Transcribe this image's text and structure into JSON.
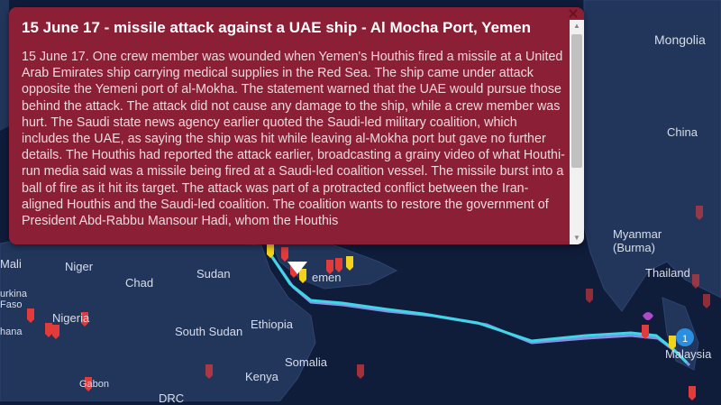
{
  "popup": {
    "title": "15 June 17 - missile attack against a UAE ship - Al Mocha Port, Yemen",
    "body": "15 June 17. One crew member was wounded when Yemen's Houthis fired a missile at a United Arab Emirates ship carrying medical supplies in the Red Sea. The ship came under attack opposite the Yemeni port of al-Mokha. The statement warned that the UAE would pursue those behind the attack. The attack did not cause any damage to the ship, while a crew member was hurt. The Saudi state news agency earlier quoted the Saudi-led military coalition, which includes the UAE, as saying the ship was hit while leaving al-Mokha port but gave no further details. The Houthis had reported the attack earlier, broadcasting a grainy video of what Houthi-run media said was a missile being fired at a Saudi-led coalition vessel. The missile burst into a ball of fire as it hit its target. The attack was part of a protracted conflict between the Iran-aligned Houthis and the Saudi-led coalition. The coalition wants to restore the government of President Abd-Rabbu Mansour Hadi, whom the Houthis",
    "close_glyph": "×"
  },
  "map_labels": {
    "mongolia": "Mongolia",
    "china": "China",
    "myanmar": "Myanmar\n(Burma)",
    "thailand": "Thailand",
    "mali": "Mali",
    "niger": "Niger",
    "chad": "Chad",
    "sudan": "Sudan",
    "yemen": "emen",
    "burkina": "urkina\nFaso",
    "nigeria": "Nigeria",
    "ghana": "hana",
    "south_sudan": "South Sudan",
    "ethiopia": "Ethiopia",
    "somalia": "Somalia",
    "kenya": "Kenya",
    "gabon": "Gabon",
    "drc": "DRC",
    "malaysia": "Malaysia"
  },
  "markers": {
    "count_badge": "1",
    "alert_glyph": "!"
  },
  "colors": {
    "ocean": "#0f1c3a",
    "land": "#22365c",
    "route_primary": "#3fd7e8",
    "route_secondary": "#8a8fe6",
    "popup_bg": "#8a1f35",
    "marker_red": "#e23b3b",
    "marker_yellow": "#f2d21a",
    "marker_blue": "#2a8fe0"
  }
}
